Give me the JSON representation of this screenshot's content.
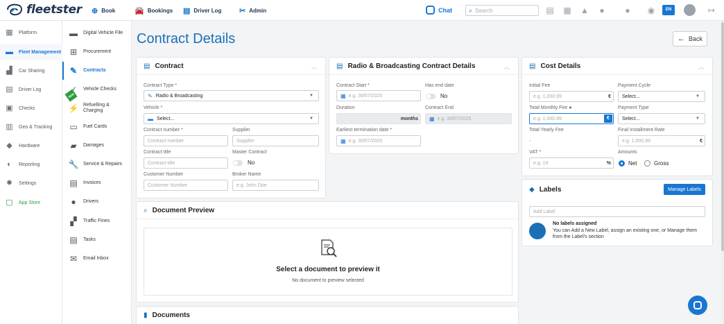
{
  "header": {
    "logo_text": "fleetster",
    "nav": [
      {
        "label": "Book",
        "icon": "plus-circle-icon"
      },
      {
        "label": "Bookings",
        "icon": "car-icon"
      },
      {
        "label": "Driver Log",
        "icon": "clipboard-icon"
      },
      {
        "label": "Admin",
        "icon": "tools-icon"
      }
    ],
    "chat_label": "Chat",
    "search_placeholder": "Search",
    "language": "EN"
  },
  "sidebar_primary": [
    {
      "label": "Platform",
      "icon": "building-icon"
    },
    {
      "label": "Fleet Management",
      "icon": "car-icon",
      "active": true
    },
    {
      "label": "Car Sharing",
      "icon": "car-sharing-icon"
    },
    {
      "label": "Driver Log",
      "icon": "logbook-icon"
    },
    {
      "label": "Checks",
      "icon": "checks-icon"
    },
    {
      "label": "Geo & Tracking",
      "icon": "map-icon"
    },
    {
      "label": "Hardware",
      "icon": "hardware-icon"
    },
    {
      "label": "Reporting",
      "icon": "pie-chart-icon"
    },
    {
      "label": "Settings",
      "icon": "gear-icon"
    },
    {
      "label": "App Store",
      "icon": "store-icon"
    }
  ],
  "sidebar_secondary": [
    {
      "label": "Digital Vehicle File",
      "icon": "car-icon"
    },
    {
      "label": "Procurement",
      "icon": "cart-icon"
    },
    {
      "label": "Contracts",
      "icon": "contract-icon",
      "active": true
    },
    {
      "label": "Vehicle Checks",
      "icon": "check-circle-icon",
      "badge": "NEW"
    },
    {
      "label": "Refuelling & Charging",
      "icon": "fuel-icon"
    },
    {
      "label": "Fuel Cards",
      "icon": "card-icon"
    },
    {
      "label": "Damages",
      "icon": "damage-icon"
    },
    {
      "label": "Service & Repairs",
      "icon": "wrench-icon"
    },
    {
      "label": "Invoices",
      "icon": "invoice-icon"
    },
    {
      "label": "Drivers",
      "icon": "driver-icon"
    },
    {
      "label": "Traffic Fines",
      "icon": "fine-icon"
    },
    {
      "label": "Tasks",
      "icon": "tasks-icon"
    },
    {
      "label": "Email Inbox",
      "icon": "mail-icon"
    }
  ],
  "page": {
    "title": "Contract Details",
    "back_label": "Back"
  },
  "contract": {
    "title": "Contract",
    "contract_type_label": "Contract Type *",
    "contract_type_value": "Radio & Broadcasting",
    "vehicle_label": "Vehicle *",
    "vehicle_value": "Select...",
    "contract_number_label": "Contract number *",
    "contract_number_placeholder": "Contract number",
    "supplier_label": "Supplier",
    "supplier_placeholder": "Supplier",
    "contract_title_label": "Contract title",
    "contract_title_placeholder": "Contract title",
    "master_contract_label": "Master Contract",
    "master_contract_value": "No",
    "customer_number_label": "Customer Number",
    "customer_number_placeholder": "Customer Number",
    "broker_name_label": "Broker Name",
    "broker_name_placeholder": "e.g. John Doe"
  },
  "radio": {
    "title": "Radio & Broadcasting Contract Details",
    "contract_start_label": "Contract Start *",
    "contract_start_placeholder": "e.g. 30/07/2025",
    "has_end_date_label": "Has end date",
    "has_end_date_value": "No",
    "duration_label": "Duration",
    "duration_unit": "months",
    "contract_end_label": "Contract End",
    "contract_end_placeholder": "e.g. 30/07/2025",
    "earliest_termination_label": "Earliest termination date *",
    "earliest_termination_placeholder": "e.g. 30/07/2025"
  },
  "cost": {
    "title": "Cost Details",
    "initial_fee_label": "Initial Fee",
    "initial_fee_placeholder": "e.g. 1,000.99",
    "currency": "€",
    "payment_cycle_label": "Payment Cycle",
    "payment_cycle_value": "Select...",
    "total_monthly_fee_label": "Total Monthly Fee",
    "total_monthly_fee_placeholder": "e.g. 1,000.99",
    "payment_type_label": "Payment Type",
    "payment_type_value": "Select...",
    "total_yearly_fee_label": "Total Yearly Fee",
    "total_yearly_fee_value": "-",
    "final_installment_label": "Final Installment Rate",
    "final_installment_placeholder": "e.g. 1,000.99",
    "vat_label": "VAT *",
    "vat_placeholder": "e.g. 19",
    "vat_unit": "%",
    "amounts_label": "Amounts",
    "amount_net": "Net",
    "amount_gross": "Gross"
  },
  "labels": {
    "title": "Labels",
    "manage_label": "Manage Labels",
    "add_placeholder": "Add Label",
    "empty_title": "No labels assigned",
    "empty_text": "You can Add a New Label, assign an existing one, or Manage them from the Label's section"
  },
  "preview": {
    "title": "Document Preview",
    "empty_title": "Select a document to preview it",
    "empty_sub": "No document to preview selected"
  },
  "documents": {
    "title": "Documents"
  },
  "colors": {
    "accent": "#1976d2",
    "title_blue": "#1a6fb5",
    "app_store_green": "#2e9b3e"
  }
}
